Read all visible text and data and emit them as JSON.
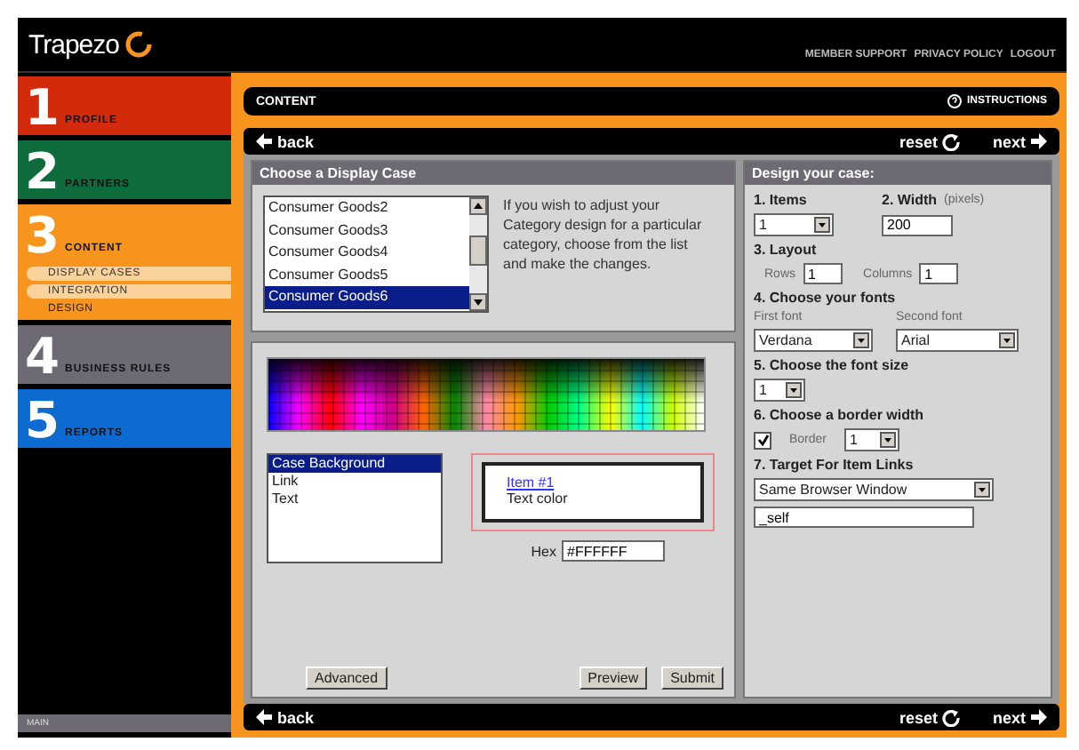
{
  "header": {
    "logo": "Trapezo",
    "links": [
      "MEMBER SUPPORT",
      "PRIVACY POLICY",
      "LOGOUT"
    ]
  },
  "sidebar": {
    "items": [
      {
        "number": "1",
        "label": "PROFILE",
        "color": "#d42a0c"
      },
      {
        "number": "2",
        "label": "PARTNERS",
        "color": "#0d6b3c"
      },
      {
        "number": "3",
        "label": "CONTENT",
        "color": "#f7941d",
        "children": [
          {
            "label": "DISPLAY CASES",
            "selected": false
          },
          {
            "label": "INTEGRATION",
            "selected": false
          },
          {
            "label": "DESIGN",
            "selected": true
          }
        ]
      },
      {
        "number": "4",
        "label": "BUSINESS RULES",
        "color": "#6d6a73"
      },
      {
        "number": "5",
        "label": "REPORTS",
        "color": "#0c6ad0"
      }
    ],
    "footer": "MAIN"
  },
  "section": {
    "title": "CONTENT",
    "instructions": "INSTRUCTIONS"
  },
  "nav_bars": [
    {
      "back": "back",
      "reset": "reset",
      "next": "next"
    },
    {
      "back": "back",
      "reset": "reset",
      "next": "next"
    }
  ],
  "display_case": {
    "title": "Choose a Display Case",
    "options": [
      {
        "label": "Consumer Goods2",
        "selected": false
      },
      {
        "label": "Consumer Goods3",
        "selected": false
      },
      {
        "label": "Consumer Goods4",
        "selected": false
      },
      {
        "label": "Consumer Goods5",
        "selected": false
      },
      {
        "label": "Consumer Goods6",
        "selected": true
      }
    ],
    "help": "If you wish to adjust your Category design for a particular category, choose from the list and make the changes."
  },
  "colors": {
    "elements": [
      {
        "label": "Case Background",
        "selected": true
      },
      {
        "label": "Link",
        "selected": false
      },
      {
        "label": "Text",
        "selected": false
      }
    ],
    "preview_link": "Item #1",
    "preview_text": "Text color",
    "hex_label": "Hex",
    "hex_value": "#FFFFFF",
    "buttons": [
      "Advanced",
      "Preview",
      "Submit"
    ]
  },
  "design": {
    "title": "Design your case:",
    "items_label": "1. Items",
    "items_value": "1",
    "width_label": "2. Width",
    "width_unit": "(pixels)",
    "width_value": "200",
    "layout_label": "3. Layout",
    "rows_label": "Rows",
    "rows_value": "1",
    "columns_label": "Columns",
    "columns_value": "1",
    "fonts_label": "4. Choose your fonts",
    "first_font_label": "First font",
    "second_font_label": "Second font",
    "first_font": "Verdana",
    "second_font": "Arial",
    "size_label": "5. Choose the font size",
    "size_value": "1",
    "border_label": "6. Choose a border width",
    "border_checked": true,
    "border_text": "Border",
    "border_value": "1",
    "target_label": "7. Target For Item Links",
    "target_value": "Same Browser Window",
    "target_field": "_self"
  }
}
